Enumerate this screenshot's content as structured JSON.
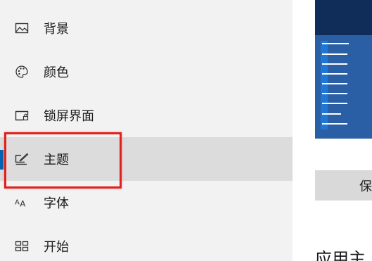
{
  "sidebar": {
    "items": [
      {
        "label": "背景",
        "icon": "picture-icon"
      },
      {
        "label": "颜色",
        "icon": "palette-icon"
      },
      {
        "label": "锁屏界面",
        "icon": "lock-screen-icon"
      },
      {
        "label": "主题",
        "icon": "theme-brush-icon",
        "selected": true
      },
      {
        "label": "字体",
        "icon": "font-icon"
      },
      {
        "label": "开始",
        "icon": "start-grid-icon"
      }
    ]
  },
  "content": {
    "save_button_label": "保",
    "section_title": "应用主"
  },
  "colors": {
    "accent": "#0063b1",
    "highlight": "#e0201e",
    "selected_bg": "#dcdcdc",
    "sidebar_bg": "#f2f2f2",
    "preview_bg": "#2b5fa5"
  }
}
